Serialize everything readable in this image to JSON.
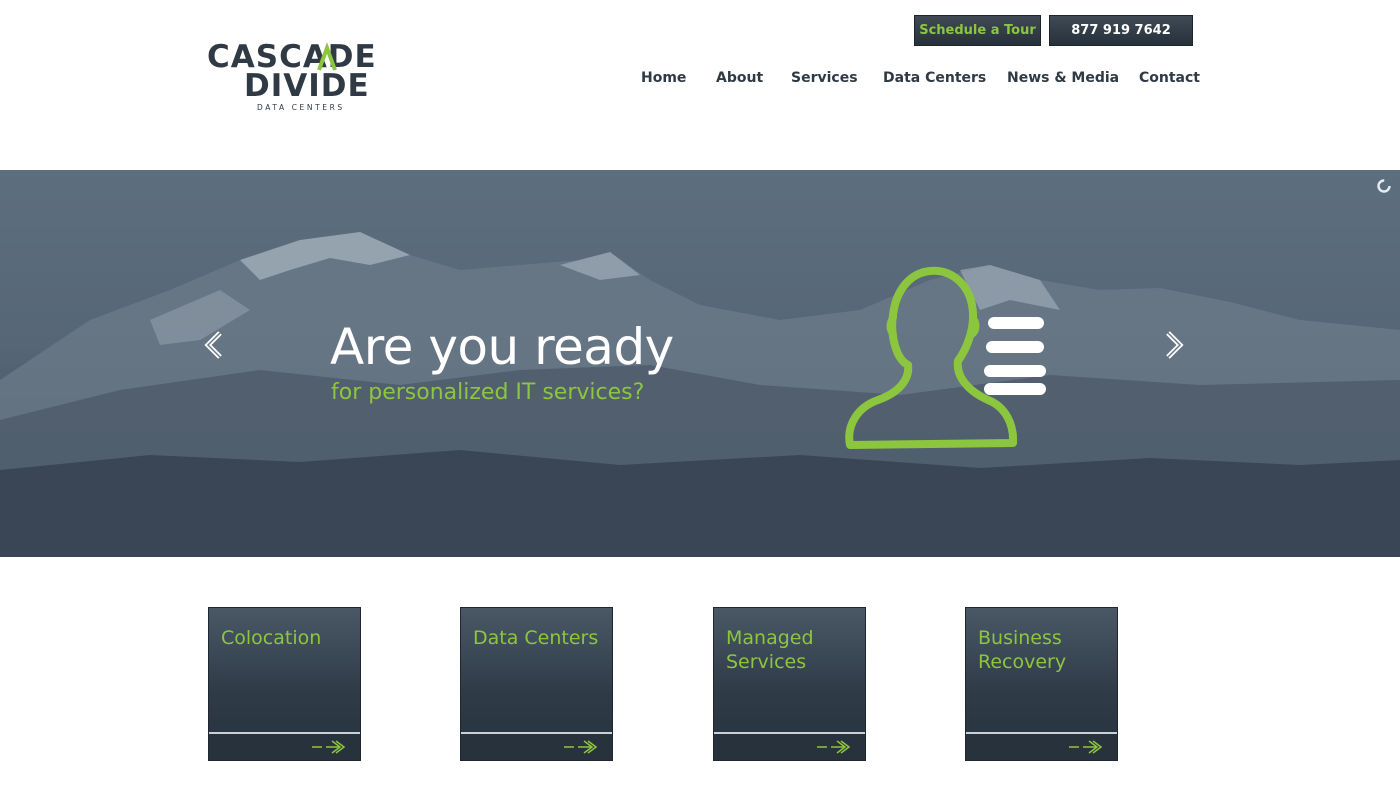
{
  "brand": {
    "logo_line1": "CASCADE",
    "logo_line2": "DIVIDE",
    "logo_sub": "DATA CENTERS",
    "accent_color": "#8cc63f",
    "dark_color": "#2f3a45"
  },
  "header": {
    "tour_button": "Schedule a Tour",
    "phone_button": "877 919 7642"
  },
  "nav": {
    "items": [
      "Home",
      "About",
      "Services",
      "Data Centers",
      "News & Media",
      "Contact"
    ]
  },
  "hero": {
    "title": "Are you ready",
    "subtitle": "for personalized IT services?",
    "prev_icon": "chevron-left-icon",
    "next_icon": "chevron-right-icon",
    "illustration_icon": "person-list-icon",
    "loader_icon": "spinner-icon"
  },
  "cards": [
    {
      "title": "Colocation",
      "icon": "arrow-right-icon"
    },
    {
      "title": "Data Centers",
      "icon": "arrow-right-icon"
    },
    {
      "title": "Managed Services",
      "icon": "arrow-right-icon"
    },
    {
      "title": "Business Recovery",
      "icon": "arrow-right-icon"
    }
  ]
}
